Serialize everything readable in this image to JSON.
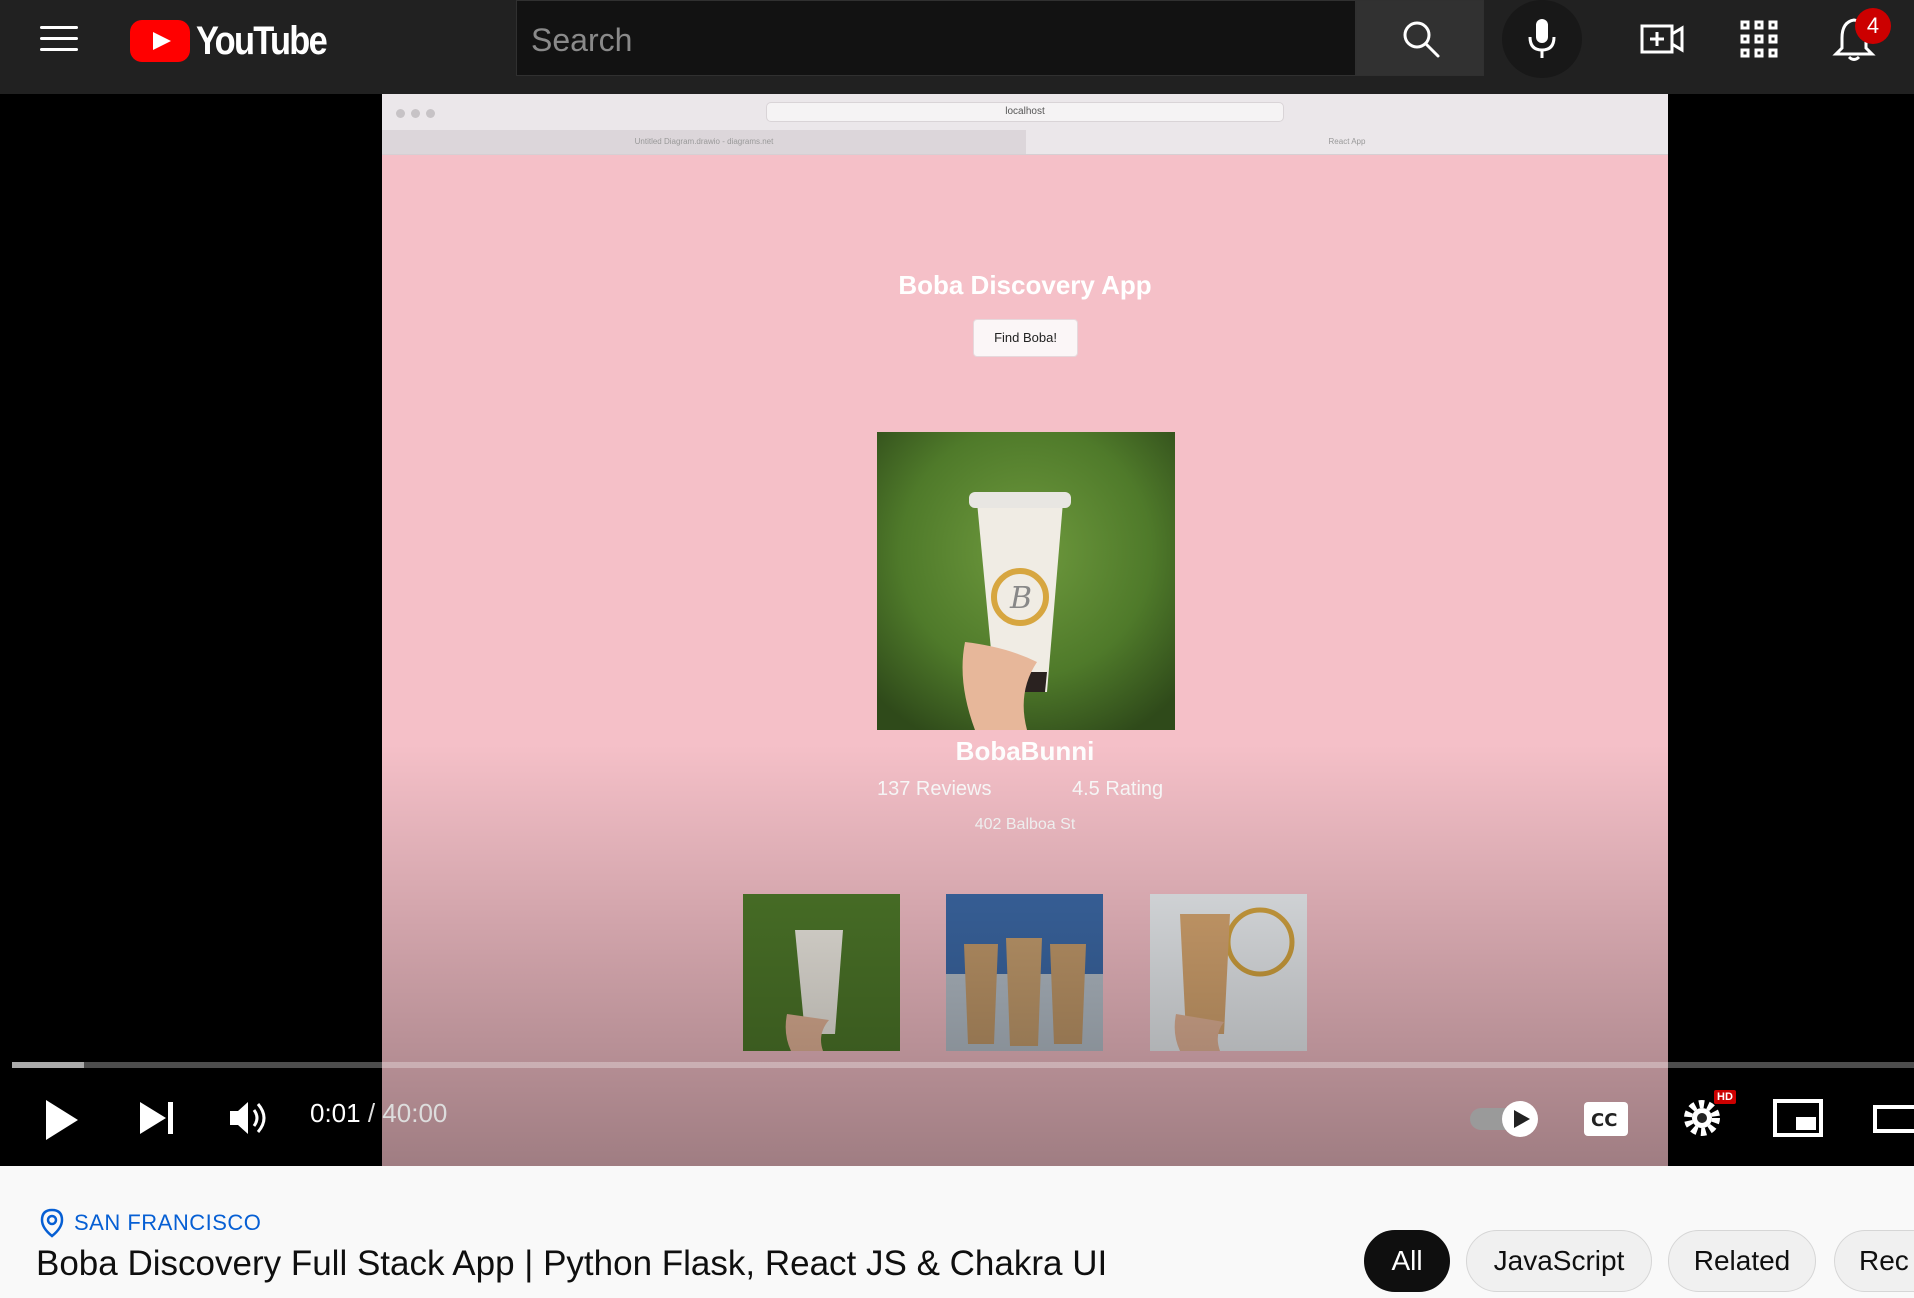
{
  "header": {
    "logo_text": "YouTube",
    "search_placeholder": "Search",
    "notification_count": "4"
  },
  "player": {
    "current_time": "0:01",
    "duration": "40:00",
    "progress_fraction": 0.0004,
    "hd_badge": "HD"
  },
  "frame": {
    "browser_url": "localhost",
    "tab_left": "Untitled Diagram.drawio - diagrams.net",
    "tab_right": "React App",
    "app_title": "Boba Discovery App",
    "find_button": "Find Boba!",
    "shop_name": "BobaBunni",
    "reviews": "137 Reviews",
    "rating": "4.5 Rating",
    "address": "402 Balboa St"
  },
  "below": {
    "location": "SAN FRANCISCO",
    "title": "Boba Discovery Full Stack App | Python Flask, React JS & Chakra UI",
    "chips": [
      "All",
      "JavaScript",
      "Related",
      "Rec"
    ]
  },
  "colors": {
    "frame_bg": "#f5c0c8",
    "youtube_red": "#ff0000",
    "link_blue": "#065fd4"
  }
}
